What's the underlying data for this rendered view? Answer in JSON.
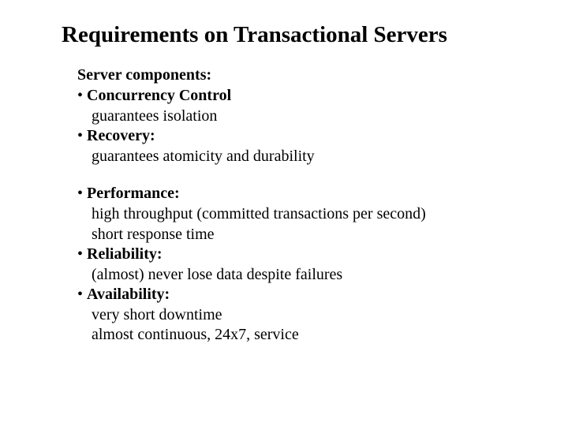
{
  "title": "Requirements on Transactional Servers",
  "section_heading": "Server components:",
  "group1": {
    "item1": {
      "bullet": "• ",
      "label": "Concurrency Control",
      "line1": "guarantees isolation"
    },
    "item2": {
      "bullet": "• ",
      "label": "Recovery:",
      "line1": "guarantees atomicity and durability"
    }
  },
  "group2": {
    "item1": {
      "bullet": "• ",
      "label": "Performance:",
      "line1": "high throughput (committed transactions per second)",
      "line2": "short response time"
    },
    "item2": {
      "bullet": "• ",
      "label": "Reliability:",
      "line1": "(almost) never lose data despite failures"
    },
    "item3": {
      "bullet": "• ",
      "label": "Availability:",
      "line1": "very short downtime",
      "line2": "almost continuous, 24x7, service"
    }
  }
}
